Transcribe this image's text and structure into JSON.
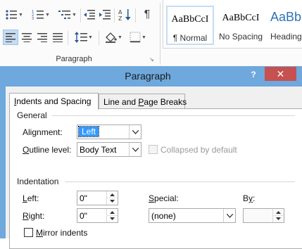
{
  "ribbon": {
    "group_label": "Paragraph",
    "launcher_glyph": "↘",
    "paragraph_mark": "¶",
    "icons": [
      "bullets-icon",
      "numbering-icon",
      "multilevel-list-icon",
      "decrease-indent-icon",
      "increase-indent-icon",
      "sort-icon",
      "show-formatting-icon",
      "align-left-icon",
      "center-icon",
      "align-right-icon",
      "justify-icon",
      "line-spacing-icon",
      "shading-icon",
      "borders-icon"
    ],
    "styles": [
      {
        "sample": "AaBbCcI",
        "name": "¶ Normal"
      },
      {
        "sample": "AaBbCcI",
        "name": "No Spacing"
      },
      {
        "sample": "AaBbC",
        "name": "Heading"
      }
    ]
  },
  "dialog": {
    "title": "Paragraph",
    "help": "?",
    "close": "✕",
    "tabs": [
      {
        "label": "Indents and Spacing",
        "mnemonic": "I",
        "rest": "ndents and Spacing"
      },
      {
        "label": "Line and Page Breaks",
        "before": "Line and ",
        "mnemonic": "P",
        "rest": "age Breaks"
      }
    ],
    "general": {
      "title": "General",
      "alignment_label": {
        "before": "Ali",
        "mnemonic": "g",
        "after": "nment:"
      },
      "alignment_value": "Left",
      "outline_label": {
        "mnemonic": "O",
        "after": "utline level:"
      },
      "outline_value": "Body Text",
      "collapsed_label": "Collapsed by default"
    },
    "indentation": {
      "title": "Indentation",
      "left_label": {
        "mnemonic": "L",
        "after": "eft:"
      },
      "left_value": "0\"",
      "right_label": {
        "mnemonic": "R",
        "after": "ight:"
      },
      "right_value": "0\"",
      "special_label": {
        "mnemonic": "S",
        "after": "pecial:"
      },
      "special_value": "(none)",
      "by_label": {
        "before": "B",
        "mnemonic": "y",
        "after": ":"
      },
      "by_value": "",
      "mirror_label": {
        "mnemonic": "M",
        "after": "irror indents"
      }
    }
  },
  "colors": {
    "dialog_frame": "#6fa8dc",
    "close_button": "#c75050",
    "selection": "#3399ff",
    "heading_style": "#2e74b5"
  }
}
